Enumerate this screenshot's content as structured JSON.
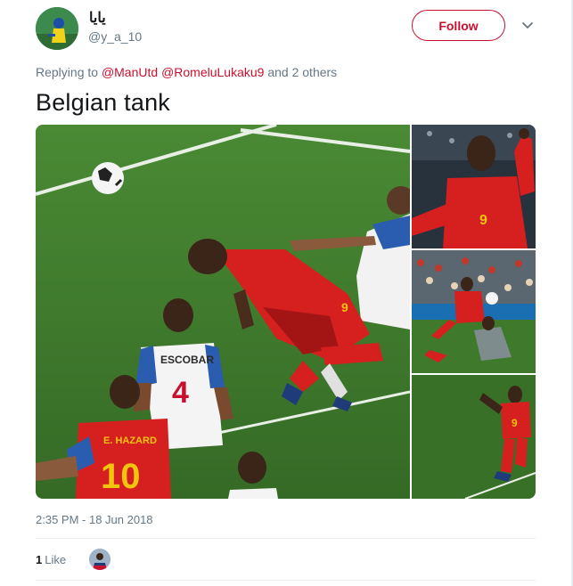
{
  "tweet": {
    "display_name": "يايا",
    "handle": "@y_a_10",
    "follow_label": "Follow",
    "replying_to_prefix": "Replying to",
    "replying_to_mentions": [
      "@ManUtd",
      "@RomeluLukaku9"
    ],
    "replying_to_suffix": "and 2 others",
    "text": "Belgian tank",
    "timestamp": "2:35 PM - 18 Jun 2018",
    "like_count": "1",
    "like_label": "Like"
  },
  "media": {
    "photos": [
      {
        "name": "main-photo",
        "players": {
          "shirt_left": "E. HAZARD",
          "number_left": "10",
          "shirt_right": "ESCOBAR",
          "number_right": "4",
          "number_lukaku": "9"
        }
      },
      {
        "name": "lukaku-celebration-photo"
      },
      {
        "name": "goal-action-photo"
      },
      {
        "name": "lukaku-running-photo",
        "number": "9"
      }
    ]
  },
  "icons": {
    "caret": "chevron-down-icon",
    "avatar": "user-avatar",
    "liker_avatar": "liker-avatar"
  },
  "colors": {
    "accent": "#c8102e",
    "pitch": "#3f7a2c",
    "belgium_red": "#d61f1f",
    "panama_white": "#f4f4f4"
  }
}
